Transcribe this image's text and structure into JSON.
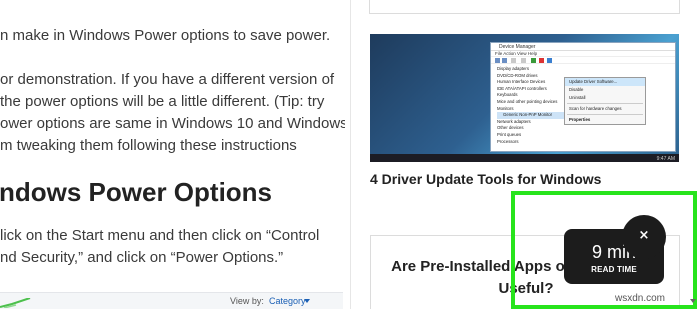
{
  "article": {
    "lines": [
      "n make in Windows Power options to save power.",
      "or demonstration. If you have a different version of",
      " the power options will be a little different. (Tip: try",
      "ower options are same in Windows 10 and Windows",
      "m tweaking them following these instructions"
    ],
    "heading": "ndows Power Options",
    "lines2": [
      "lick on the Start menu and then click on “Control",
      "nd Security,” and click on “Power Options.”"
    ],
    "panel": {
      "view_by_label": "View by:",
      "view_by_value": "Category"
    }
  },
  "sidebar": {
    "thumbnail": {
      "window_title": "Device Manager",
      "menu": "File   Action   View   Help",
      "tree": [
        "Display adapters",
        "DVD/CD-ROM drives",
        "Human Interface Devices",
        "IDE ATA/ATAPI controllers",
        "Keyboards",
        "Mice and other pointing devices",
        "Monitors",
        "Generic Non-PnP Monitor",
        "Network adapters",
        "Other devices",
        "Print queues",
        "Processors"
      ],
      "context_menu": [
        "Update Driver Software...",
        "Disable",
        "Uninstall",
        "Scan for hardware changes",
        "Properties"
      ],
      "clock": "9:47 AM"
    },
    "card_title": "4 Driver Update Tools for Windows",
    "promo_title": "Are Pre-Installed Apps on Your Phone Useful?"
  },
  "read_time": {
    "value": "9 min",
    "label": "READ TIME",
    "close": "×"
  },
  "watermark": "wsxdn.com",
  "colors": {
    "highlight": "#27e41c",
    "overlay": "#1c1c1c",
    "link_blue": "#1a5fb4"
  }
}
